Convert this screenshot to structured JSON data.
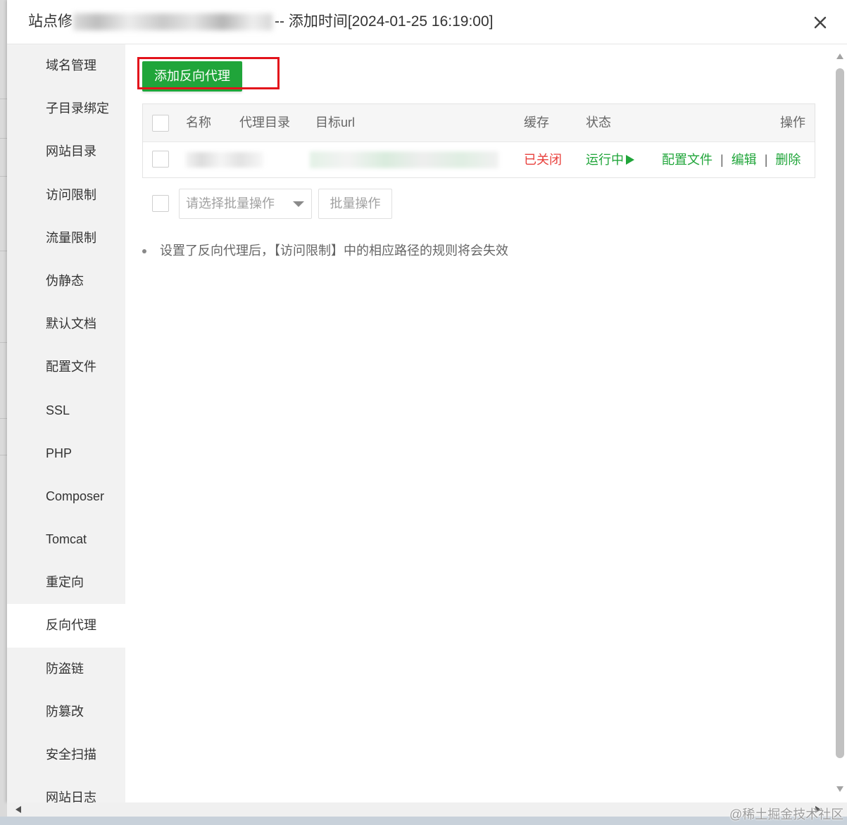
{
  "dialog": {
    "title_prefix": "站点修",
    "title_suffix": "-- 添加时间[2024-01-25 16:19:00]"
  },
  "nav": {
    "items": [
      {
        "label": "域名管理"
      },
      {
        "label": "子目录绑定"
      },
      {
        "label": "网站目录"
      },
      {
        "label": "访问限制"
      },
      {
        "label": "流量限制"
      },
      {
        "label": "伪静态"
      },
      {
        "label": "默认文档"
      },
      {
        "label": "配置文件"
      },
      {
        "label": "SSL"
      },
      {
        "label": "PHP"
      },
      {
        "label": "Composer"
      },
      {
        "label": "Tomcat"
      },
      {
        "label": "重定向"
      },
      {
        "label": "反向代理",
        "active": true
      },
      {
        "label": "防盗链"
      },
      {
        "label": "防篡改"
      },
      {
        "label": "安全扫描"
      },
      {
        "label": "网站日志"
      }
    ]
  },
  "main": {
    "add_button": "添加反向代理",
    "table": {
      "columns": {
        "name": "名称",
        "proxy_dir": "代理目录",
        "target_url": "目标url",
        "cache": "缓存",
        "status": "状态",
        "actions": "操作"
      },
      "rows": [
        {
          "cache": "已关闭",
          "status": "运行中",
          "actions": [
            "配置文件",
            "编辑",
            "删除"
          ],
          "separator": "|"
        }
      ]
    },
    "batch": {
      "select_placeholder": "请选择批量操作",
      "button": "批量操作"
    },
    "notes": [
      "设置了反向代理后，【访问限制】中的相应路径的规则将会失效"
    ]
  },
  "watermark": "@稀土掘金技术社区",
  "icons": {
    "close": "close-icon",
    "status": "play-icon",
    "select": "caret-down-icon",
    "scroll_up": "scroll-up-arrow-icon",
    "scroll_down": "scroll-down-arrow-icon",
    "scroll_left": "scroll-left-arrow-icon",
    "scroll_right": "scroll-right-arrow-icon"
  },
  "colors": {
    "primary_green": "#20a53a",
    "danger_red": "#e8403c",
    "annotation_red": "#e3131b"
  }
}
